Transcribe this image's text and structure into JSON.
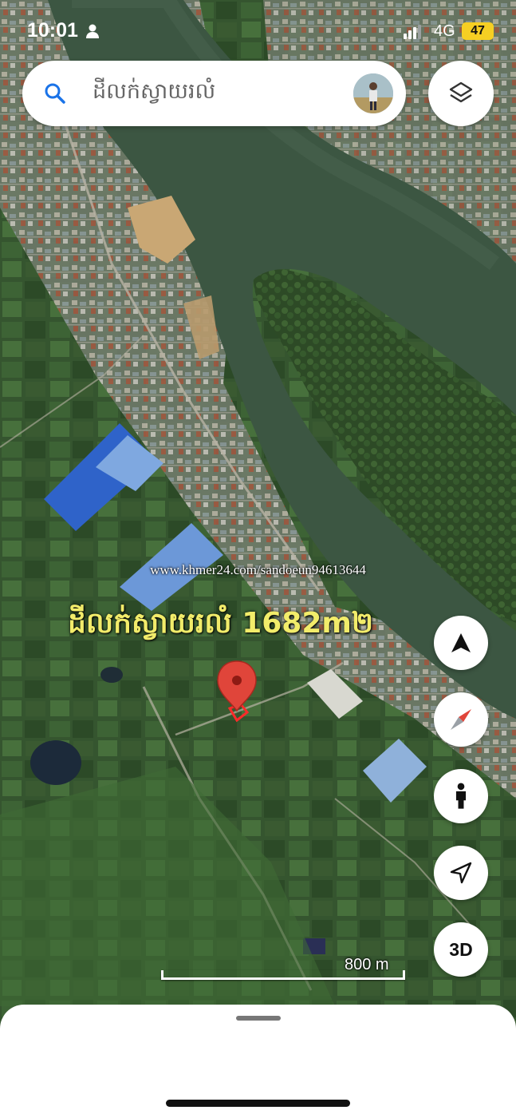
{
  "status_bar": {
    "time": "10:01",
    "network": "4G",
    "battery": "47"
  },
  "search": {
    "query": "ដីលក់ស្វាយរលំ",
    "search_icon": "search-icon",
    "avatar_icon": "profile-avatar"
  },
  "map": {
    "watermark": "www.khmer24.com/sandoeun94613644",
    "label": "ដីលក់ស្វាយរលំ 1682m២",
    "scale_label": "800 m",
    "marker_color": "#e0453a",
    "parcel_outline_color": "#ff2a2a"
  },
  "controls": {
    "layers_icon": "layers-icon",
    "navigation_icon": "navigation-arrow-icon",
    "compass_icon": "compass-icon",
    "street_view_icon": "pegman-icon",
    "location_icon": "my-location-icon",
    "three_d_label": "3D"
  }
}
